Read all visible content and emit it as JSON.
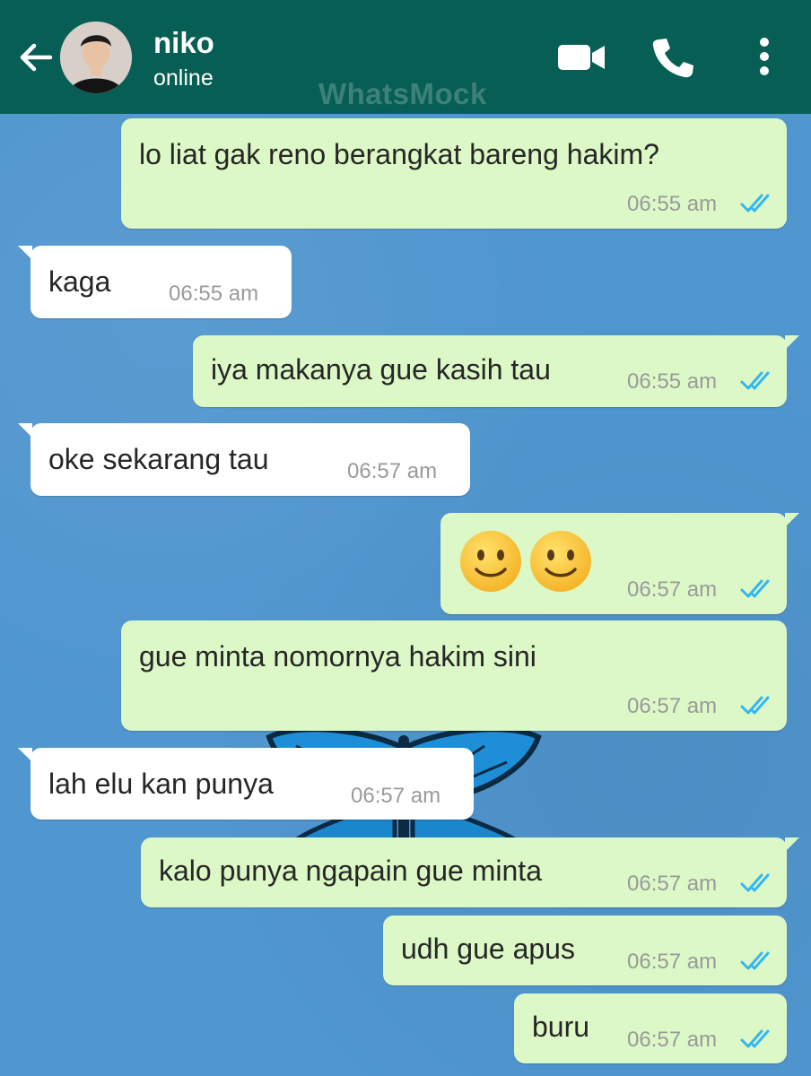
{
  "header": {
    "contact_name": "niko",
    "contact_status": "online",
    "watermark": "WhatsMock",
    "icons": [
      "back-arrow-icon",
      "avatar",
      "video-call-icon",
      "phone-call-icon",
      "more-vert-icon"
    ]
  },
  "colors": {
    "header_bg": "#075e54",
    "outgoing_bubble": "#dcf8c6",
    "incoming_bubble": "#ffffff",
    "read_ticks": "#34b7f1",
    "chat_bg": "#5096cf"
  },
  "messages": [
    {
      "direction": "outgoing",
      "text": "lo liat gak reno berangkat bareng hakim?",
      "time": "06:55 am",
      "status": "read"
    },
    {
      "direction": "incoming",
      "text": "kaga",
      "time": "06:55 am"
    },
    {
      "direction": "outgoing",
      "text": "iya makanya gue kasih tau",
      "time": "06:55 am",
      "status": "read"
    },
    {
      "direction": "incoming",
      "text": "oke sekarang tau",
      "time": "06:57 am"
    },
    {
      "direction": "outgoing",
      "text": "🙂🙂",
      "emoji": [
        "slightly-smiling-face",
        "slightly-smiling-face"
      ],
      "time": "06:57 am",
      "status": "read"
    },
    {
      "direction": "outgoing",
      "text": "gue minta nomornya hakim sini",
      "time": "06:57 am",
      "status": "read"
    },
    {
      "direction": "incoming",
      "text": "lah elu kan punya",
      "time": "06:57 am"
    },
    {
      "direction": "outgoing",
      "text": "kalo punya ngapain gue minta",
      "time": "06:57 am",
      "status": "read"
    },
    {
      "direction": "outgoing",
      "text": "udh gue apus",
      "time": "06:57 am",
      "status": "read"
    },
    {
      "direction": "outgoing",
      "text": "buru",
      "time": "06:57 am",
      "status": "read"
    }
  ]
}
